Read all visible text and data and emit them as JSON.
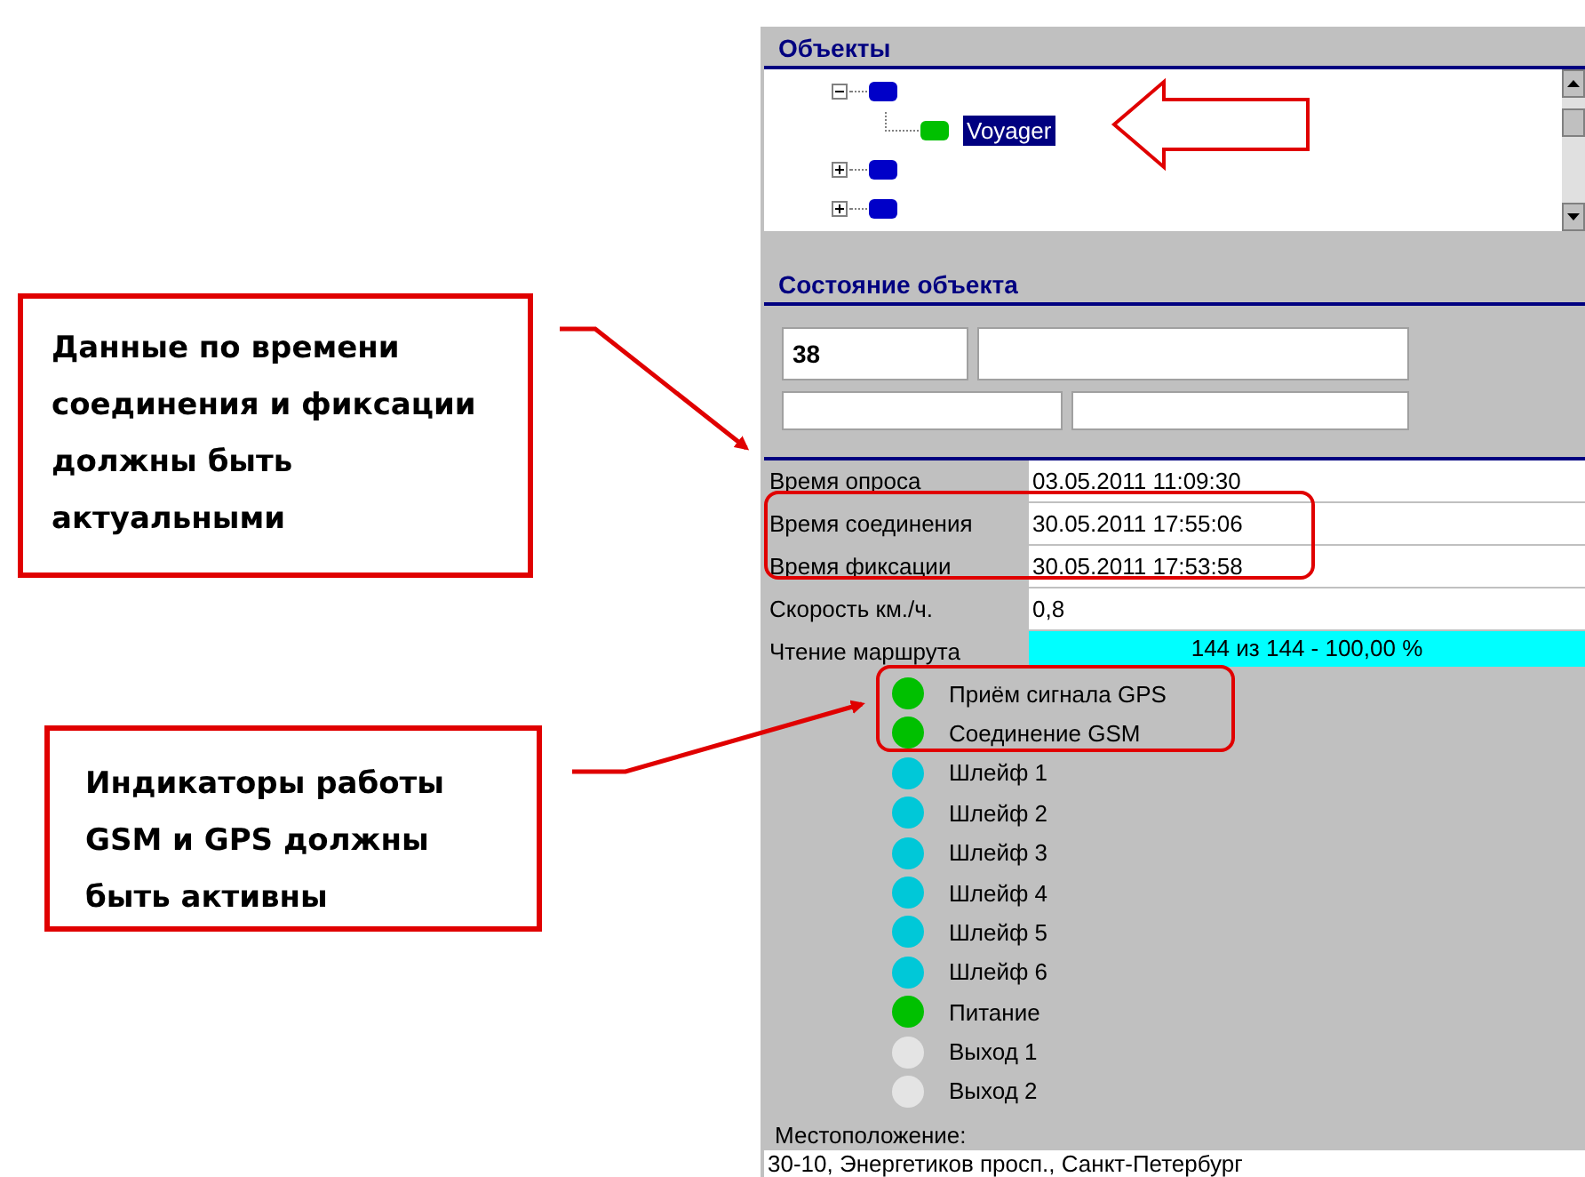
{
  "callouts": [
    {
      "text": "Данные по времени соединения и фиксации должны быть актуальными"
    },
    {
      "text": "Индикаторы работы GSM и GPS должны быть активны"
    }
  ],
  "objects": {
    "title": "Объекты",
    "tree": [
      {
        "expanded": true,
        "color": "#0000c8",
        "children": [
          {
            "label": "Voyager",
            "selected": true,
            "color": "#00c000"
          }
        ]
      },
      {
        "expanded": false,
        "color": "#0000c8"
      },
      {
        "expanded": false,
        "color": "#0000c8"
      }
    ]
  },
  "state": {
    "title": "Состояние объекта",
    "fields": [
      {
        "value": "38"
      }
    ],
    "rows": [
      {
        "label": "Время опроса",
        "value": "03.05.2011 11:09:30"
      },
      {
        "label": "Время соединения",
        "value": "30.05.2011 17:55:06"
      },
      {
        "label": "Время фиксации",
        "value": "30.05.2011 17:53:58"
      },
      {
        "label": "Скорость км./ч.",
        "value": "0,8"
      }
    ],
    "progress": {
      "label": "Чтение маршрута",
      "level": 1.0,
      "reading": "144 из 144 - 100,00 %"
    },
    "indicators": [
      {
        "label": "Приём сигнала GPS",
        "color": "#00c000"
      },
      {
        "label": "Соединение GSM",
        "color": "#00c000"
      },
      {
        "label": "Шлейф 1",
        "color": "#00c8d8"
      },
      {
        "label": "Шлейф 2",
        "color": "#00c8d8"
      },
      {
        "label": "Шлейф 3",
        "color": "#00c8d8"
      },
      {
        "label": "Шлейф 4",
        "color": "#00c8d8"
      },
      {
        "label": "Шлейф 5",
        "color": "#00c8d8"
      },
      {
        "label": "Шлейф 6",
        "color": "#00c8d8"
      },
      {
        "label": "Питание",
        "color": "#00c000"
      },
      {
        "label": "Выход 1",
        "color": "#e4e4e4"
      },
      {
        "label": "Выход 2",
        "color": "#e4e4e4"
      }
    ],
    "location_label": "Местоположение:",
    "location": "30-10, Энергетиков просп., Санкт-Петербург"
  }
}
